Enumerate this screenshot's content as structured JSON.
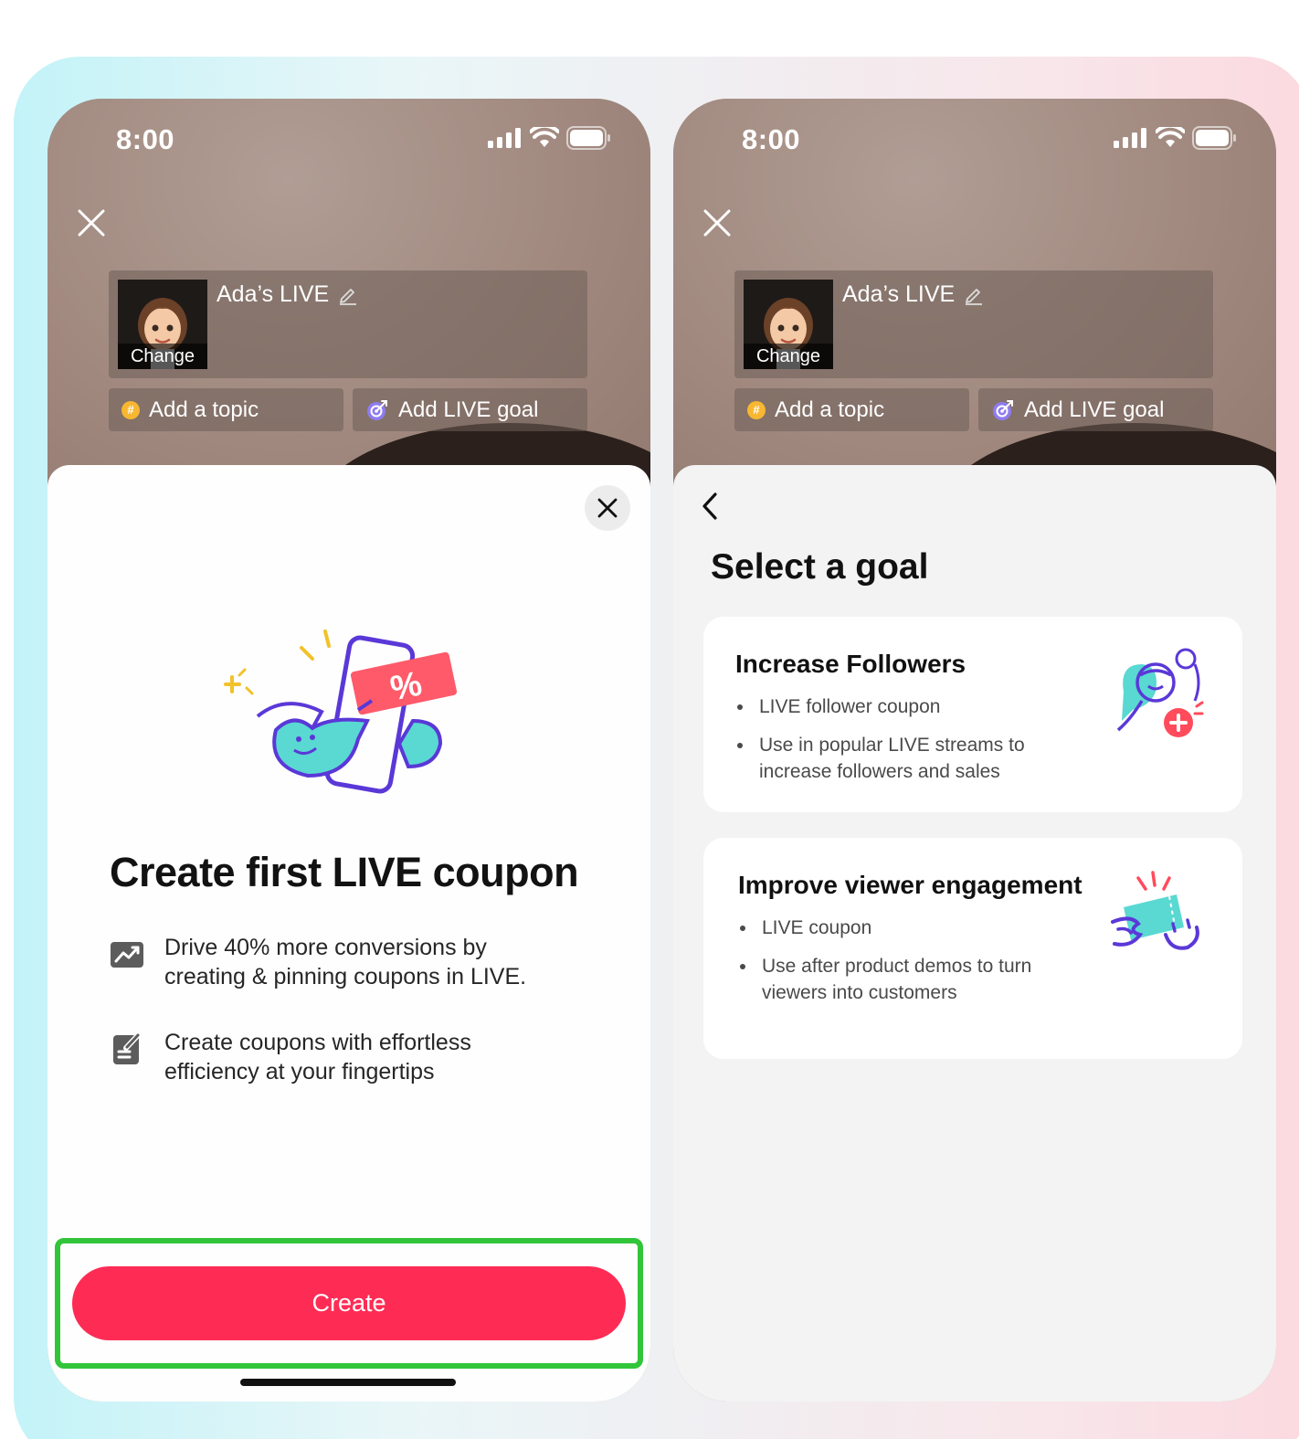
{
  "status": {
    "time": "8:00"
  },
  "live": {
    "title": "Ada’s LIVE",
    "cover_change": "Change",
    "add_topic": "Add a topic",
    "add_goal": "Add LIVE goal",
    "topic_badge": "#"
  },
  "left_sheet": {
    "title": "Create first LIVE coupon",
    "features": [
      {
        "text": "Drive 40% more conversions by creating & pinning coupons in LIVE."
      },
      {
        "text": "Create coupons with effortless efficiency at your fingertips"
      }
    ],
    "create_label": "Create",
    "coupon_symbol": "%"
  },
  "right_sheet": {
    "title": "Select a goal",
    "goals": [
      {
        "name": "Increase Followers",
        "bullets": [
          "LIVE follower coupon",
          "Use in popular LIVE streams to increase followers and sales"
        ]
      },
      {
        "name": "Improve viewer engagement",
        "bullets": [
          "LIVE coupon",
          "Use after product demos to turn viewers into customers"
        ]
      }
    ]
  },
  "colors": {
    "brand": "#fe2c55",
    "highlight": "#32c53a",
    "illustration_teal": "#5ad8d2",
    "illustration_purple": "#5a38d8"
  }
}
